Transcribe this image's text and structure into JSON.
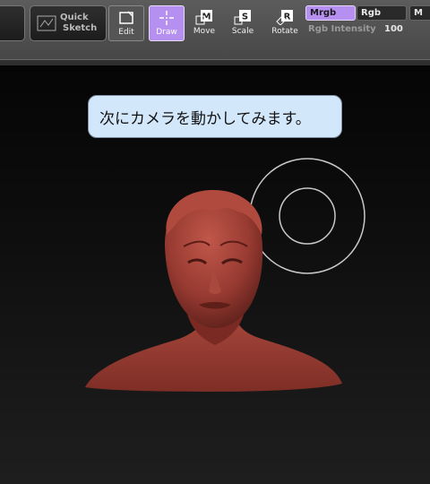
{
  "toolbar": {
    "quick_sketch": {
      "line1": "Quick",
      "line2": "Sketch"
    },
    "tools": [
      {
        "label": "Edit"
      },
      {
        "label": "Draw",
        "active": true
      },
      {
        "label": "Move"
      },
      {
        "label": "Scale"
      },
      {
        "label": "Rotate"
      }
    ],
    "mrgb_label": "Mrgb",
    "rgb_label": "Rgb",
    "m_label": "M",
    "rgb_intensity_label": "Rgb Intensity",
    "rgb_intensity_value": "100"
  },
  "bubble": {
    "text": "次にカメラを動かしてみます。"
  },
  "colors": {
    "active_accent": "#b590f0",
    "bubble_bg": "#d3e7fb",
    "model": "#9b3b31"
  }
}
